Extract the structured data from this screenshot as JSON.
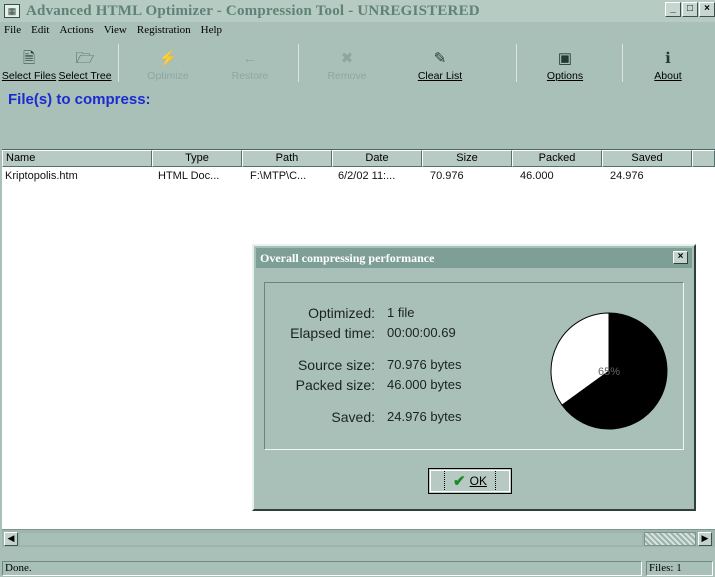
{
  "window": {
    "title": "Advanced HTML Optimizer - Compression Tool - UNREGISTERED",
    "minimize_label": "_",
    "maximize_label": "□",
    "close_label": "×"
  },
  "menu": [
    "File",
    "Edit",
    "Actions",
    "View",
    "Registration",
    "Help"
  ],
  "toolbar": {
    "select_files": "Select Files",
    "select_tree": "Select Tree",
    "optimize": "Optimize",
    "restore": "Restore",
    "remove": "Remove",
    "clear_list": "Clear List",
    "options": "Options",
    "about": "About"
  },
  "section_label": "File(s) to compress:",
  "list": {
    "columns": [
      "Name",
      "Type",
      "Path",
      "Date",
      "Size",
      "Packed",
      "Saved"
    ],
    "rows": [
      [
        "Kriptopolis.htm",
        "HTML Doc...",
        "F:\\MTP\\C...",
        "6/2/02 11:...",
        "70.976",
        "46.000",
        "24.976"
      ]
    ]
  },
  "status": {
    "left": "Done.",
    "right": "Files: 1"
  },
  "dialog": {
    "title": "Overall compressing performance",
    "close_label": "×",
    "labels": {
      "optimized": "Optimized:",
      "elapsed": "Elapsed time:",
      "source": "Source size:",
      "packed": "Packed size:",
      "saved": "Saved:"
    },
    "values": {
      "optimized": "1 file",
      "elapsed": "00:00:00.69",
      "source": "70.976 bytes",
      "packed": "46.000 bytes",
      "saved": "24.976 bytes"
    },
    "pie_label": "65%",
    "ok_label": "OK"
  },
  "chart_data": {
    "type": "pie",
    "values": [
      65,
      35
    ],
    "colors": [
      "#000000",
      "#ffffff"
    ]
  },
  "colors": {
    "window_bg": "#a9c0b8",
    "title_text": "#5f8179",
    "section_label": "#1a2bd0",
    "dialog_title_bg": "#7e9f96"
  }
}
